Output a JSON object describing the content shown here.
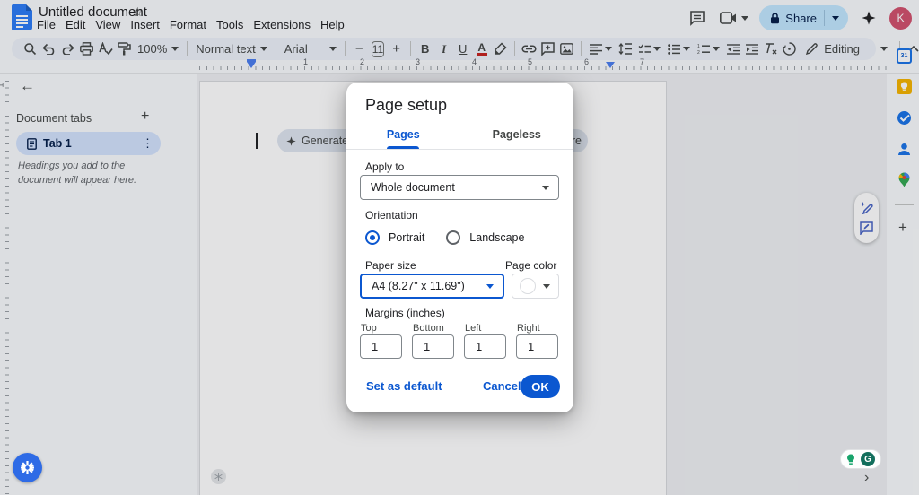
{
  "header": {
    "doc_title": "Untitled document",
    "menus": [
      "File",
      "Edit",
      "View",
      "Insert",
      "Format",
      "Tools",
      "Extensions",
      "Help"
    ],
    "share_label": "Share",
    "avatar_initial": "K"
  },
  "toolbar": {
    "zoom_value": "100%",
    "style_value": "Normal text",
    "font_value": "Arial",
    "font_size_value": "11",
    "mode_value": "Editing",
    "minus": "−",
    "plus": "+",
    "bold": "B",
    "italic": "I",
    "underline": "U",
    "text_color": "A"
  },
  "ruler": {
    "numbers": [
      "1",
      "2",
      "3",
      "4",
      "5",
      "6",
      "7"
    ]
  },
  "sidebar": {
    "title": "Document tabs",
    "tab_label": "Tab 1",
    "empty_note": "Headings you add to the document will appear here."
  },
  "canvas": {
    "generate_chip_label": "Generate doc",
    "more_chip_label": "More"
  },
  "dialog": {
    "title": "Page setup",
    "tabs": [
      {
        "label": "Pages"
      },
      {
        "label": "Pageless"
      }
    ],
    "apply_to_label": "Apply to",
    "apply_to_value": "Whole document",
    "orientation_label": "Orientation",
    "orientation_options": [
      {
        "label": "Portrait"
      },
      {
        "label": "Landscape"
      }
    ],
    "paper_size_label": "Paper size",
    "paper_size_value": "A4 (8.27\" x 11.69\")",
    "page_color_label": "Page color",
    "margins_label": "Margins (inches)",
    "margin_fields": [
      {
        "label": "Top",
        "value": "1"
      },
      {
        "label": "Bottom",
        "value": "1"
      },
      {
        "label": "Left",
        "value": "1"
      },
      {
        "label": "Right",
        "value": "1"
      }
    ],
    "set_default_label": "Set as default",
    "cancel_label": "Cancel",
    "ok_label": "OK"
  },
  "side_panel": {
    "calendar_day": "31"
  },
  "extensions": {
    "grammarly_initial": "G"
  },
  "icons": {
    "star": "☆",
    "kebab": "⋮",
    "plus": "+",
    "back_arrow": "←",
    "chevron_right": "›"
  },
  "colors": {
    "accent_blue": "#0b57d0",
    "share_pill_bg": "#c2e7ff",
    "active_tab_bg": "#d3e3fd",
    "avatar_bg": "#d2516e",
    "keep_yellow": "#f5b400",
    "grammarly_green": "#126e5c",
    "extension_blue": "#2e6be6"
  }
}
